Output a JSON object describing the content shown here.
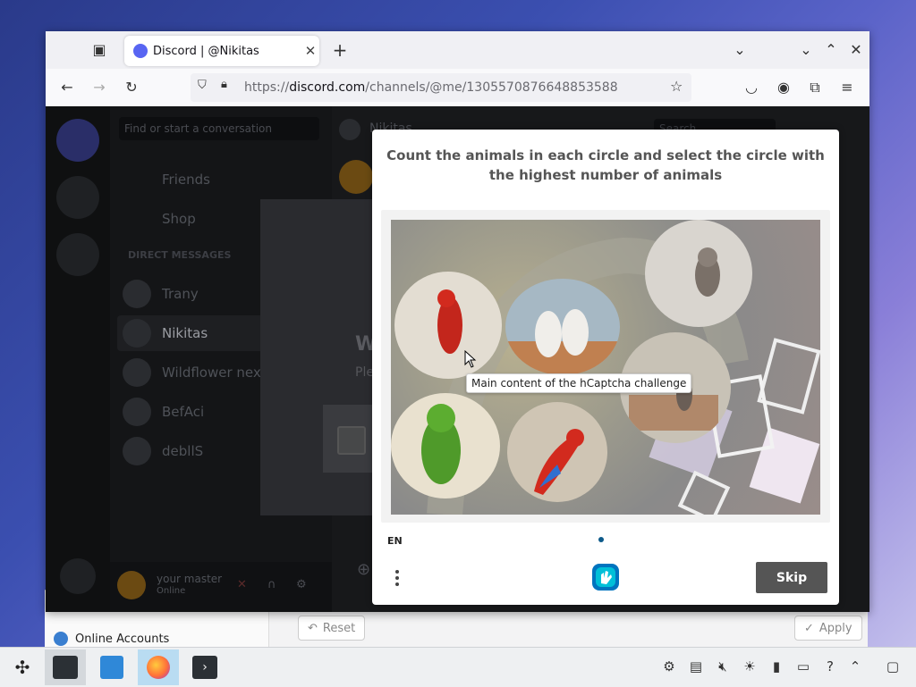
{
  "browser": {
    "tab_title": "Discord | @Nikitas",
    "url_prefix": "https://",
    "url_domain": "discord.com",
    "url_path": "/channels/@me/1305570876648853588"
  },
  "discord": {
    "search_placeholder": "Find or start a conversation",
    "nav_friends": "Friends",
    "nav_shop": "Shop",
    "dm_header": "DIRECT MESSAGES",
    "dms": [
      "Trany",
      "Nikitas",
      "Wildflower next",
      "BefAci",
      "debllS"
    ],
    "chat_user": "Nikitas",
    "chat_search": "Search",
    "modal_heading_fragment": "W",
    "modal_text_fragment": "Ple",
    "user_name": "your master",
    "user_status": "Online"
  },
  "captcha": {
    "question": "Count the animals in each circle and select the circle with the highest number of animals",
    "tooltip": "Main content of the hCaptcha challenge",
    "language": "EN",
    "skip_label": "Skip"
  },
  "background_window": {
    "sidebar_item": "Online Accounts",
    "reset_label": "Reset",
    "apply_label": "Apply"
  }
}
